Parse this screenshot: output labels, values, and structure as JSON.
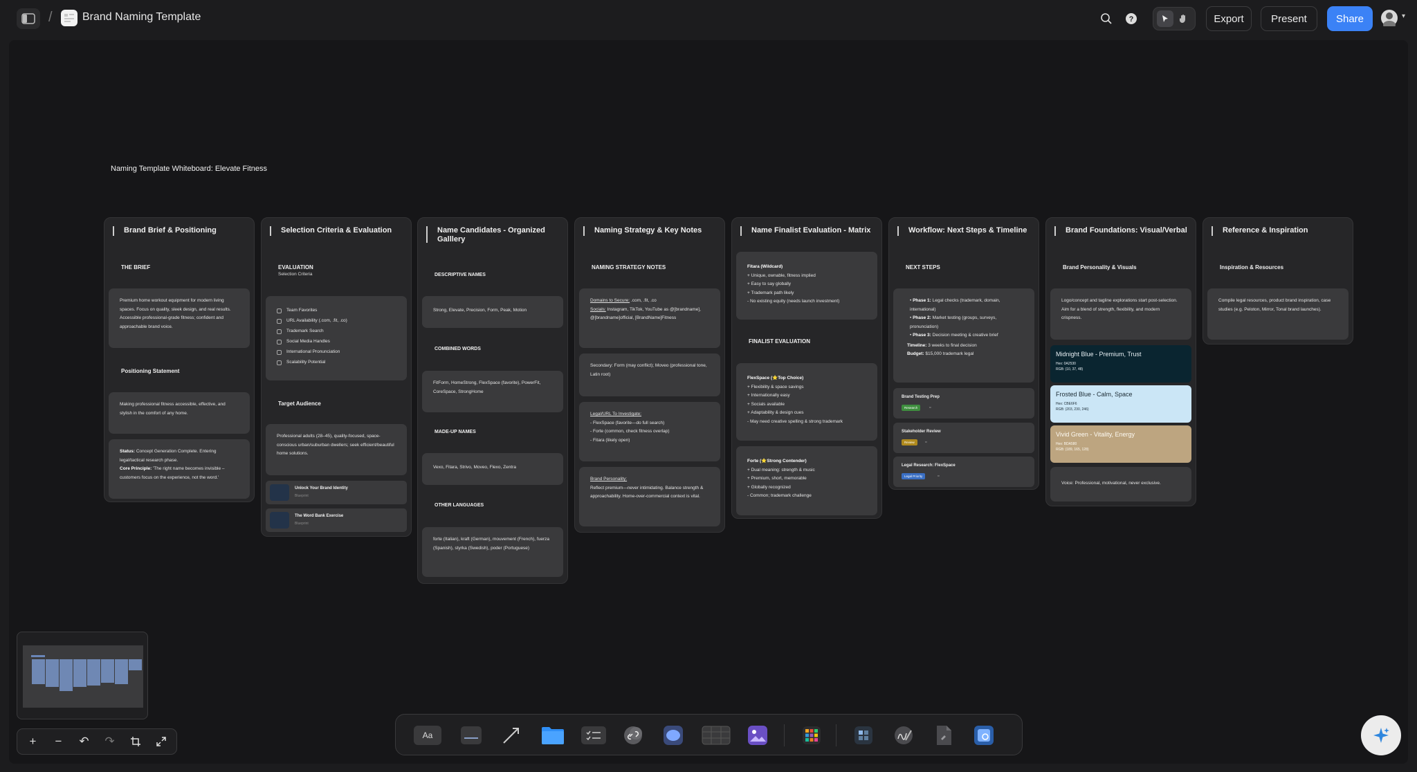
{
  "app": {
    "doc_title": "Brand Naming Template",
    "breadcrumb_sep": "/",
    "export_label": "Export",
    "present_label": "Present",
    "share_label": "Share",
    "accent": "#3b82f6"
  },
  "board": {
    "title": "Naming Template Whiteboard: Elevate Fitness",
    "columns": [
      {
        "title": "Brand Brief & Positioning",
        "the_brief": "THE BRIEF",
        "brief_text": "Premium home workout equipment for modern living spaces. Focus on quality, sleek design, and real results. Accessible professional-grade fitness; confident and approachable brand voice.",
        "positioning_heading": "Positioning Statement",
        "positioning_text": "Making professional fitness accessible, effective, and stylish in the comfort of any home.",
        "status_label": "Status:",
        "status_text": "Concept Generation Complete. Entering legal/tactical research phase.",
        "principle_label": "Core Principle:",
        "principle_text": "'The right name becomes invisible – customers focus on the experience, not the word.'"
      },
      {
        "title": "Selection Criteria & Evaluation",
        "eval_heading": "EVALUATION",
        "eval_sub": "Selection Criteria",
        "criteria": [
          "Team Favorites",
          "URL Availability (.com, .fit, .co)",
          "Trademark Search",
          "Social Media Handles",
          "International Pronunciation",
          "Scalability Potential"
        ],
        "audience_heading": "Target Audience",
        "audience_text": "Professional adults (28–45), quality-focused, space-conscious urban/suburban dwellers; seek efficient/beautiful home solutions.",
        "link1_title": "Unlock Your Brand Identity",
        "link1_sub": "Blueprint",
        "link2_title": "The Word Bank Exercise",
        "link2_sub": "Blueprint"
      },
      {
        "title": "Name Candidates - Organized Galllery",
        "descriptive_heading": "DESCRIPTIVE NAMES",
        "descriptive_text": "Strong, Elevate, Precision, Form, Peak, Motion",
        "combined_heading": "COMBINED WORDS",
        "combined_text": "FitForm, HomeStrong, FlexSpace (favorite), PowerFit, CoreSpace, StrongHome",
        "madeup_heading": "MADE-UP NAMES",
        "madeup_text": "Vexo, Fitara, Strivo, Moveo, Flexo, Zentra",
        "other_heading": "OTHER LANGUAGES",
        "other_text": "forte (Italian), kraft (German), mouvement (French), fuerza (Spanish), styrka (Swedish), poder (Portuguese)"
      },
      {
        "title": "Naming Strategy & Key Notes",
        "notes_heading": "NAMING STRATEGY NOTES",
        "domains_label": "Domains to Secure:",
        "domains_text": " .com, .fit, .co",
        "socials_label": "Socials:",
        "socials_text": " Instagram, TikTok, YouTube as @[brandname], @[brandname]official, [BrandName]Fitness",
        "secondary_text": "Secondary: Form (may conflict); Moveo (professional tone, Latin root)",
        "legal_label": "Legal/URL To Investigate:",
        "legal_items": [
          "- FlexSpace (favorite—do full search)",
          "- Forte (common, check fitness overlap)",
          "- Fitara (likely open)"
        ],
        "personality_label": "Brand Personality:",
        "personality_text": "Reflect premium—never intimidating. Balance strength & approachability. Home-over-commercial context is vital."
      },
      {
        "title": "Name Finalist Evaluation - Matrix",
        "fitara_title": "Fitara (Wildcard)",
        "fitara_items": [
          "+ Unique, ownable, fitness implied",
          "+ Easy to say globally",
          "+ Trademark path likely",
          "- No existing equity (needs launch investment)"
        ],
        "finalist_heading": "FINALIST EVALUATION",
        "flex_title": "FlexSpace (⭐Top Choice)",
        "flex_items": [
          "+ Flexibility & space savings",
          "+ Internationally easy",
          "+ Socials available",
          "+ Adaptability & design cues",
          "- May need creative spelling & strong trademark"
        ],
        "forte_title": "Forte (⭐Strong Contender)",
        "forte_items": [
          "+ Dual meaning: strength & music",
          "+ Premium, short, memorable",
          "+ Globally recognized",
          "- Common; trademark challenge"
        ]
      },
      {
        "title": "Workflow: Next Steps & Timeline",
        "next_heading": "NEXT STEPS",
        "phase1_label": "Phase 1:",
        "phase1_text": " Legal checks (trademark, domain, international)",
        "phase2_label": "Phase 2:",
        "phase2_text": " Market testing (groups, surveys, pronunciation)",
        "phase3_label": "Phase 3:",
        "phase3_text": " Decision meeting & creative brief",
        "timeline_label": "Timeline:",
        "timeline_text": " 3 weeks to final decision",
        "budget_label": "Budget:",
        "budget_text": " $15,000 trademark legal",
        "task1_title": "Brand Testing Prep",
        "task1_tag": "Research",
        "task2_title": "Stakeholder Review",
        "task2_tag": "Review",
        "task3_title": "Legal Research: FlexSpace",
        "task3_tag": "Legal Priority"
      },
      {
        "title": "Brand Foundations: Visual/Verbal",
        "personality_heading": "Brand Personality & Visuals",
        "personality_text": "Logo/concept and tagline explorations start post-selection. Aim for a blend of strength, flexibility, and modern crispness.",
        "swatches": [
          {
            "name": "Midnight Blue - Premium, Trust",
            "hex": "Hex: 0A2530",
            "rgb": "RGB: (10, 37, 48)",
            "bg": "#0a2530",
            "fg": "#e8f0f4"
          },
          {
            "name": "Frosted Blue - Calm, Space",
            "hex": "Hex: CBE6F6",
            "rgb": "RGB: (203, 230, 246)",
            "bg": "#cbe6f6",
            "fg": "#1b2a33"
          },
          {
            "name": "Vivid Green - Vitality, Energy",
            "hex": "Hex: BDA580",
            "rgb": "RGB: (189, 165, 128)",
            "bg": "#bda580",
            "fg": "#fdfaf2"
          }
        ],
        "voice_text": "Voice: Professional, motivational, never exclusive."
      },
      {
        "title": "Reference & Inspiration",
        "resources_heading": "Inspiration & Resources",
        "resources_text": "Compile legal resources, product brand inspiration, case studies (e.g. Peloton, Mirror, Tonal brand launches)."
      }
    ]
  },
  "toolbar_icons": [
    "text-icon",
    "sticky-icon",
    "line-icon",
    "folder-icon",
    "checklist-icon",
    "link-icon",
    "comment-icon",
    "table-icon",
    "image-icon",
    "apps-icon",
    "template-icon",
    "draw-icon",
    "file-icon",
    "capture-icon"
  ]
}
